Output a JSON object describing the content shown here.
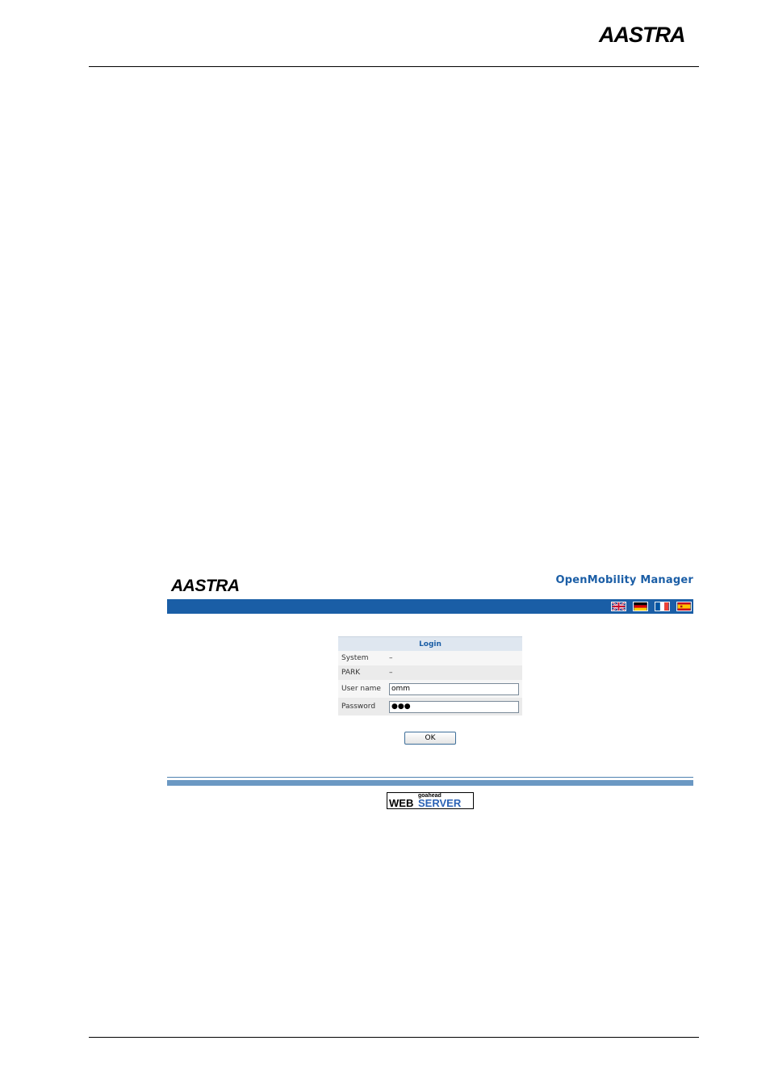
{
  "document": {
    "header_logo_text": "AASTRA"
  },
  "omm": {
    "logo_text": "AASTRA",
    "title": "OpenMobility Manager",
    "languages": [
      {
        "name": "english-flag-icon"
      },
      {
        "name": "german-flag-icon"
      },
      {
        "name": "french-flag-icon"
      },
      {
        "name": "spanish-flag-icon"
      }
    ],
    "login": {
      "heading": "Login",
      "system_label": "System",
      "system_value": "–",
      "park_label": "PARK",
      "park_value": "–",
      "username_label": "User name",
      "username_value": "omm",
      "password_label": "Password",
      "password_value": "●●●",
      "ok_label": "OK"
    },
    "webserver_badge": {
      "small": "goahead",
      "web": "WEB",
      "server": "SERVER"
    }
  }
}
